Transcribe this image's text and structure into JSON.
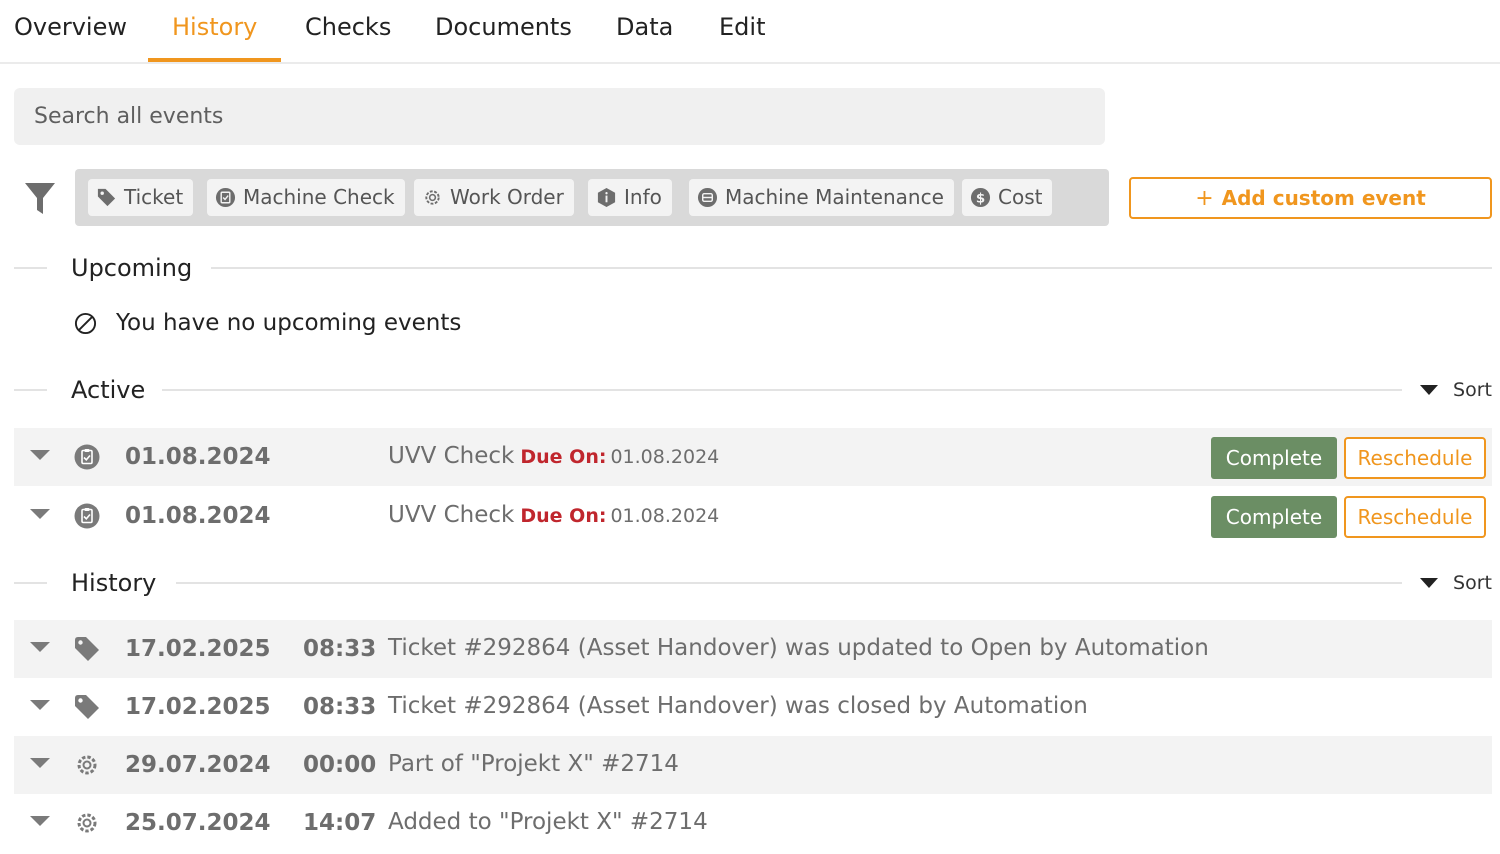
{
  "tabs": [
    {
      "label": "Overview"
    },
    {
      "label": "History",
      "active": true
    },
    {
      "label": "Checks"
    },
    {
      "label": "Documents"
    },
    {
      "label": "Data"
    },
    {
      "label": "Edit"
    }
  ],
  "search": {
    "placeholder": "Search all events",
    "value": ""
  },
  "filters": {
    "chips": [
      {
        "label": "Ticket",
        "icon": "tag-icon"
      },
      {
        "label": "Machine Check",
        "icon": "clipboard-check-icon"
      },
      {
        "label": "Work Order",
        "icon": "gear-icon"
      },
      {
        "label": "Info",
        "icon": "info-icon"
      },
      {
        "label": "Machine Maintenance",
        "icon": "maintenance-icon"
      },
      {
        "label": "Cost",
        "icon": "dollar-icon"
      }
    ],
    "add_label": "Add custom event"
  },
  "upcoming": {
    "title": "Upcoming",
    "empty_text": "You have no upcoming events"
  },
  "active": {
    "title": "Active",
    "sort_label": "Sort",
    "rows": [
      {
        "date": "01.08.2024",
        "title": "UVV Check",
        "due_label": "Due On:",
        "due_date": "01.08.2024",
        "complete_label": "Complete",
        "reschedule_label": "Reschedule",
        "icon": "clipboard-check-icon"
      },
      {
        "date": "01.08.2024",
        "title": "UVV Check",
        "due_label": "Due On:",
        "due_date": "01.08.2024",
        "complete_label": "Complete",
        "reschedule_label": "Reschedule",
        "icon": "clipboard-check-icon"
      }
    ]
  },
  "history": {
    "title": "History",
    "sort_label": "Sort",
    "rows": [
      {
        "date": "17.02.2025",
        "time": "08:33",
        "text": "Ticket #292864 (Asset Handover) was updated to Open by Automation",
        "icon": "tag-icon"
      },
      {
        "date": "17.02.2025",
        "time": "08:33",
        "text": "Ticket #292864 (Asset Handover) was closed by Automation",
        "icon": "tag-icon"
      },
      {
        "date": "29.07.2024",
        "time": "00:00",
        "text": "Part of \"Projekt X\" #2714",
        "icon": "gear-icon"
      },
      {
        "date": "25.07.2024",
        "time": "14:07",
        "text": "Added to \"Projekt X\" #2714",
        "icon": "gear-icon"
      }
    ]
  },
  "colors": {
    "accent": "#f0961e",
    "complete": "#6b8e64",
    "due": "#c0262d"
  }
}
